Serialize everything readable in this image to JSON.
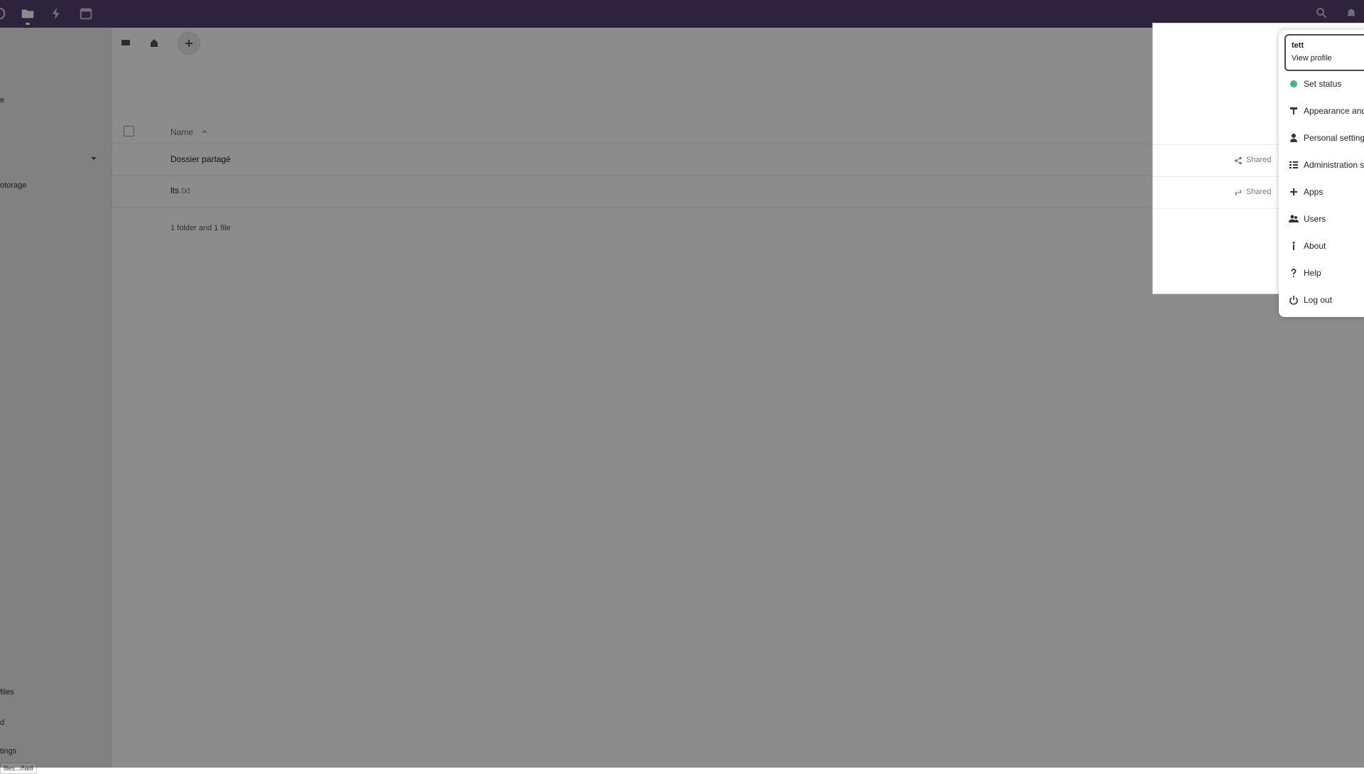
{
  "sidebar": {
    "partial_labels": [
      "e",
      "otorage",
      "files",
      "d",
      "tings"
    ],
    "tooltip": "files.../Nell"
  },
  "main": {
    "column_name": "Name",
    "rows": [
      {
        "name": "Dossier partagé",
        "ext": "",
        "shared_label": "Shared"
      },
      {
        "name": "lts",
        "ext": ".txt",
        "shared_label": "Shared"
      }
    ],
    "summary": "1 folder and 1 file"
  },
  "user_menu": {
    "user_name": "tett",
    "view_profile": "View profile",
    "items": [
      {
        "icon": "status-dot",
        "label": "Set status"
      },
      {
        "icon": "paint-brush-icon",
        "label": "Appearance and accessibility"
      },
      {
        "icon": "person-icon",
        "label": "Personal settings"
      },
      {
        "icon": "admin-list-icon",
        "label": "Administration settings"
      },
      {
        "icon": "plus-icon",
        "label": "Apps"
      },
      {
        "icon": "users-icon",
        "label": "Users"
      },
      {
        "icon": "info-icon",
        "label": "About"
      },
      {
        "icon": "help-icon",
        "label": "Help"
      },
      {
        "icon": "power-icon",
        "label": "Log out"
      }
    ]
  },
  "colors": {
    "header": "#53406f",
    "status_online": "#48b38b"
  }
}
